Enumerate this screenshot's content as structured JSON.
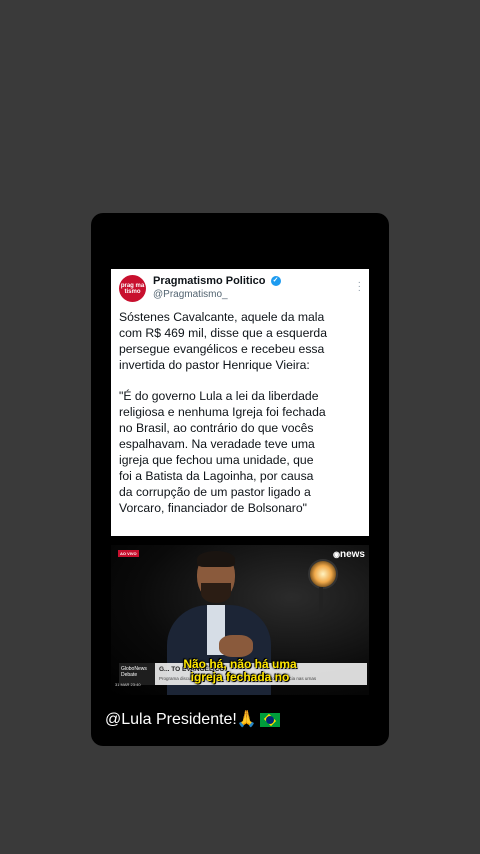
{
  "tweet": {
    "avatar_text": "prag ma tismo",
    "name": "Pragmatismo Politico",
    "handle": "@Pragmatismo_",
    "paragraph1": "Sóstenes Cavalcante, aquele da mala\ncom R$ 469 mil, disse que a esquerda\npersegue evangélicos e recebeu essa\ninvertida do pastor Henrique Vieira:",
    "paragraph2": "\"É do governo Lula a lei da liberdade\nreligiosa e nenhuma Igreja foi fechada\nno Brasil, ao contrário do que vocês\nespalhavam. Na veradade teve uma\nigreja que fechou uma unidade, que\nfoi a Batista da Lagoinha, por causa\nda corrupção de um pastor ligado a\nVorcaro, financiador de Bolsonaro\""
  },
  "video": {
    "live_tag": "AO VIVO",
    "channel": "news",
    "chyron_program": "GloboNews Debate",
    "chyron_title": "G... TO EVANGÉLICO",
    "chyron_subtitle": "Programa discute a atuação da ... e a política e como isso influencia nas urnas",
    "chyron_date": "31 MAR 23:40",
    "subtitle_line1": "Não há, não há uma",
    "subtitle_line2": "igreja fechada no"
  },
  "caption": {
    "text": "@Lula Presidente!🙏"
  },
  "icons": {
    "verified": "verified-badge-icon",
    "more": "more-options-icon",
    "flag": "brazil-flag-icon"
  }
}
